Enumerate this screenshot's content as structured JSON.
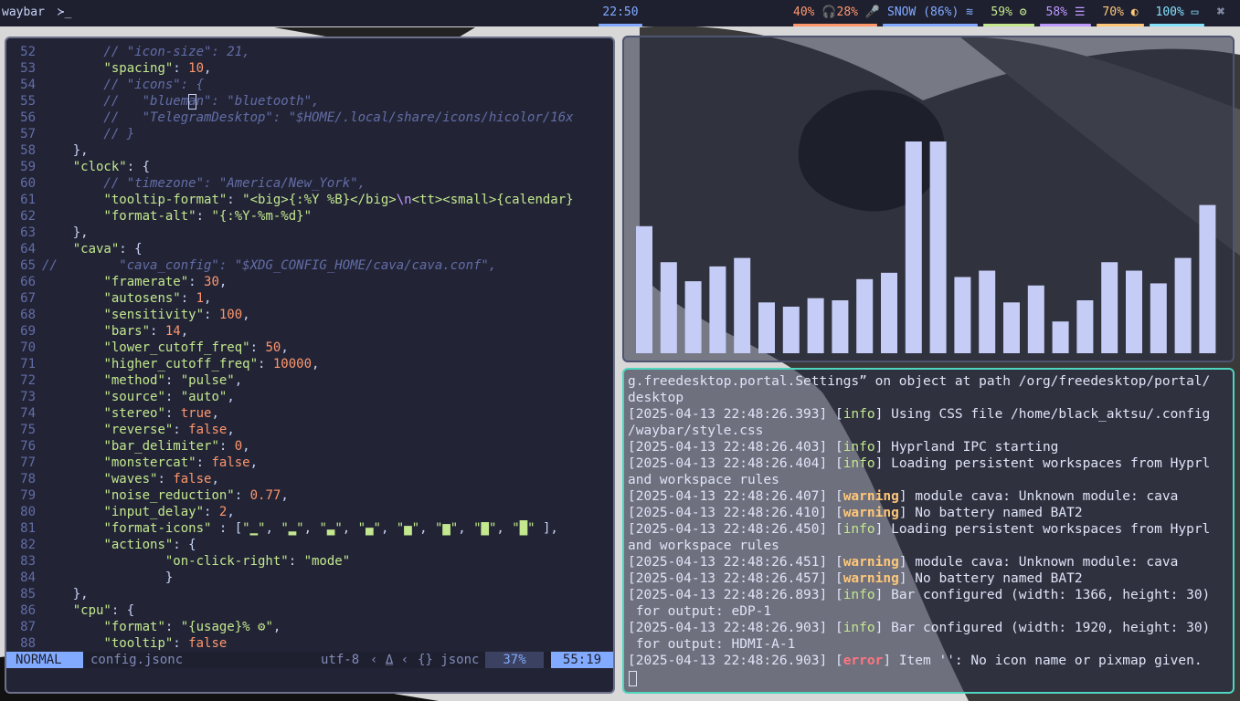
{
  "topbar": {
    "app_name": "waybar",
    "clock": "22:50",
    "volume": "40%",
    "headset": "28%",
    "network": "SNOW (86%)",
    "cpu": "59%",
    "memory": "58%",
    "backlight": "70%",
    "battery": "100%",
    "colors": {
      "bg": "#1e2030",
      "clock": "#82aaff",
      "volume": "#ff966c",
      "network": "#82aaff",
      "cpu": "#c3e88d",
      "memory": "#c099ff",
      "backlight": "#ffc777",
      "battery": "#86e1fc"
    }
  },
  "editor": {
    "lines": [
      {
        "n": "52",
        "t": [
          [
            "c",
            "        // \"icon-size\": 21,"
          ]
        ]
      },
      {
        "n": "53",
        "t": [
          [
            "p",
            "        "
          ],
          [
            "k",
            "\"spacing\""
          ],
          [
            "p",
            ": "
          ],
          [
            "n",
            "10"
          ],
          [
            "p",
            ","
          ]
        ]
      },
      {
        "n": "54",
        "t": [
          [
            "c",
            "        // \"icons\": {"
          ]
        ]
      },
      {
        "n": "55",
        "t": [
          [
            "c",
            "        //   \"blueman\": \"bluetooth\","
          ]
        ]
      },
      {
        "n": "56",
        "t": [
          [
            "c",
            "        //   \"TelegramDesktop\": \"$HOME/.local/share/icons/hicolor/16x"
          ]
        ]
      },
      {
        "n": "57",
        "t": [
          [
            "c",
            "        // }"
          ]
        ]
      },
      {
        "n": "58",
        "t": [
          [
            "p",
            "    },"
          ]
        ]
      },
      {
        "n": "59",
        "t": [
          [
            "p",
            "    "
          ],
          [
            "k",
            "\"clock\""
          ],
          [
            "p",
            ": {"
          ]
        ]
      },
      {
        "n": "60",
        "t": [
          [
            "c",
            "        // \"timezone\": \"America/New_York\","
          ]
        ]
      },
      {
        "n": "61",
        "t": [
          [
            "p",
            "        "
          ],
          [
            "k",
            "\"tooltip-format\""
          ],
          [
            "p",
            ": "
          ],
          [
            "s",
            "\"<big>{:%Y %B}</big>"
          ],
          [
            "e",
            "\\n"
          ],
          [
            "s",
            "<tt><small>{calendar}"
          ]
        ]
      },
      {
        "n": "62",
        "t": [
          [
            "p",
            "        "
          ],
          [
            "k",
            "\"format-alt\""
          ],
          [
            "p",
            ": "
          ],
          [
            "s",
            "\"{:%Y-%m-%d}\""
          ]
        ]
      },
      {
        "n": "63",
        "t": [
          [
            "p",
            "    },"
          ]
        ]
      },
      {
        "n": "64",
        "t": [
          [
            "p",
            "    "
          ],
          [
            "k",
            "\"cava\""
          ],
          [
            "p",
            ": {"
          ]
        ]
      },
      {
        "n": "65",
        "t": [
          [
            "c",
            "//        \"cava_config\": \"$XDG_CONFIG_HOME/cava/cava.conf\","
          ]
        ]
      },
      {
        "n": "66",
        "t": [
          [
            "p",
            "        "
          ],
          [
            "k",
            "\"framerate\""
          ],
          [
            "p",
            ": "
          ],
          [
            "n",
            "30"
          ],
          [
            "p",
            ","
          ]
        ]
      },
      {
        "n": "67",
        "t": [
          [
            "p",
            "        "
          ],
          [
            "k",
            "\"autosens\""
          ],
          [
            "p",
            ": "
          ],
          [
            "n",
            "1"
          ],
          [
            "p",
            ","
          ]
        ]
      },
      {
        "n": "68",
        "t": [
          [
            "p",
            "        "
          ],
          [
            "k",
            "\"sensitivity\""
          ],
          [
            "p",
            ": "
          ],
          [
            "n",
            "100"
          ],
          [
            "p",
            ","
          ]
        ]
      },
      {
        "n": "69",
        "t": [
          [
            "p",
            "        "
          ],
          [
            "k",
            "\"bars\""
          ],
          [
            "p",
            ": "
          ],
          [
            "n",
            "14"
          ],
          [
            "p",
            ","
          ]
        ]
      },
      {
        "n": "70",
        "t": [
          [
            "p",
            "        "
          ],
          [
            "k",
            "\"lower_cutoff_freq\""
          ],
          [
            "p",
            ": "
          ],
          [
            "n",
            "50"
          ],
          [
            "p",
            ","
          ]
        ]
      },
      {
        "n": "71",
        "t": [
          [
            "p",
            "        "
          ],
          [
            "k",
            "\"higher_cutoff_freq\""
          ],
          [
            "p",
            ": "
          ],
          [
            "n",
            "10000"
          ],
          [
            "p",
            ","
          ]
        ]
      },
      {
        "n": "72",
        "t": [
          [
            "p",
            "        "
          ],
          [
            "k",
            "\"method\""
          ],
          [
            "p",
            ": "
          ],
          [
            "s",
            "\"pulse\""
          ],
          [
            "p",
            ","
          ]
        ]
      },
      {
        "n": "73",
        "t": [
          [
            "p",
            "        "
          ],
          [
            "k",
            "\"source\""
          ],
          [
            "p",
            ": "
          ],
          [
            "s",
            "\"auto\""
          ],
          [
            "p",
            ","
          ]
        ]
      },
      {
        "n": "74",
        "t": [
          [
            "p",
            "        "
          ],
          [
            "k",
            "\"stereo\""
          ],
          [
            "p",
            ": "
          ],
          [
            "n",
            "true"
          ],
          [
            "p",
            ","
          ]
        ]
      },
      {
        "n": "75",
        "t": [
          [
            "p",
            "        "
          ],
          [
            "k",
            "\"reverse\""
          ],
          [
            "p",
            ": "
          ],
          [
            "n",
            "false"
          ],
          [
            "p",
            ","
          ]
        ]
      },
      {
        "n": "76",
        "t": [
          [
            "p",
            "        "
          ],
          [
            "k",
            "\"bar_delimiter\""
          ],
          [
            "p",
            ": "
          ],
          [
            "n",
            "0"
          ],
          [
            "p",
            ","
          ]
        ]
      },
      {
        "n": "77",
        "t": [
          [
            "p",
            "        "
          ],
          [
            "k",
            "\"monstercat\""
          ],
          [
            "p",
            ": "
          ],
          [
            "n",
            "false"
          ],
          [
            "p",
            ","
          ]
        ]
      },
      {
        "n": "78",
        "t": [
          [
            "p",
            "        "
          ],
          [
            "k",
            "\"waves\""
          ],
          [
            "p",
            ": "
          ],
          [
            "n",
            "false"
          ],
          [
            "p",
            ","
          ]
        ]
      },
      {
        "n": "79",
        "t": [
          [
            "p",
            "        "
          ],
          [
            "k",
            "\"noise_reduction\""
          ],
          [
            "p",
            ": "
          ],
          [
            "n",
            "0.77"
          ],
          [
            "p",
            ","
          ]
        ]
      },
      {
        "n": "80",
        "t": [
          [
            "p",
            "        "
          ],
          [
            "k",
            "\"input_delay\""
          ],
          [
            "p",
            ": "
          ],
          [
            "n",
            "2"
          ],
          [
            "p",
            ","
          ]
        ]
      },
      {
        "n": "81",
        "t": [
          [
            "p",
            "        "
          ],
          [
            "k",
            "\"format-icons\""
          ],
          [
            "p",
            " : ["
          ],
          [
            "s",
            "\"▁\""
          ],
          [
            "p",
            ", "
          ],
          [
            "s",
            "\"▂\""
          ],
          [
            "p",
            ", "
          ],
          [
            "s",
            "\"▃\""
          ],
          [
            "p",
            ", "
          ],
          [
            "s",
            "\"▄\""
          ],
          [
            "p",
            ", "
          ],
          [
            "s",
            "\"▅\""
          ],
          [
            "p",
            ", "
          ],
          [
            "s",
            "\"▆\""
          ],
          [
            "p",
            ", "
          ],
          [
            "s",
            "\"▇\""
          ],
          [
            "p",
            ", "
          ],
          [
            "s",
            "\"█\""
          ],
          [
            "p",
            " ],"
          ]
        ]
      },
      {
        "n": "82",
        "t": [
          [
            "p",
            "        "
          ],
          [
            "k",
            "\"actions\""
          ],
          [
            "p",
            ": {"
          ]
        ]
      },
      {
        "n": "83",
        "t": [
          [
            "p",
            "                "
          ],
          [
            "k",
            "\"on-click-right\""
          ],
          [
            "p",
            ": "
          ],
          [
            "s",
            "\"mode\""
          ]
        ]
      },
      {
        "n": "84",
        "t": [
          [
            "p",
            "                }"
          ]
        ]
      },
      {
        "n": "85",
        "t": [
          [
            "p",
            "    },"
          ]
        ]
      },
      {
        "n": "86",
        "t": [
          [
            "p",
            "    "
          ],
          [
            "k",
            "\"cpu\""
          ],
          [
            "p",
            ": {"
          ]
        ]
      },
      {
        "n": "87",
        "t": [
          [
            "p",
            "        "
          ],
          [
            "k",
            "\"format\""
          ],
          [
            "p",
            ": "
          ],
          [
            "s",
            "\"{usage}% ⚙\""
          ],
          [
            "p",
            ","
          ]
        ]
      },
      {
        "n": "88",
        "t": [
          [
            "p",
            "        "
          ],
          [
            "k",
            "\"tooltip\""
          ],
          [
            "p",
            ": "
          ],
          [
            "n",
            "false"
          ]
        ]
      }
    ],
    "status": {
      "mode": "NORMAL",
      "file": "config.jsonc",
      "encoding": "utf-8",
      "filetype": "{} jsonc",
      "percent": "37%",
      "position": "55:19"
    }
  },
  "cava": {
    "levels": [
      0.6,
      0.43,
      0.34,
      0.41,
      0.45,
      0.24,
      0.22,
      0.26,
      0.25,
      0.35,
      0.38,
      1.0,
      1.0,
      0.36,
      0.39,
      0.24,
      0.32,
      0.15,
      0.25,
      0.43,
      0.39,
      0.33,
      0.45,
      0.7
    ],
    "bar_color": "#c5cdf6"
  },
  "terminal": {
    "lines": [
      [
        [
          "t",
          "g.freedesktop.portal.Settings” on object at path /org/freedesktop/portal/"
        ]
      ],
      [
        [
          "t",
          "desktop"
        ]
      ],
      [
        [
          "t",
          "[2025-04-13 22:48:26.393] ["
        ],
        [
          "i",
          "info"
        ],
        [
          "t",
          "] Using CSS file /home/black_aktsu/.config"
        ]
      ],
      [
        [
          "t",
          "/waybar/style.css"
        ]
      ],
      [
        [
          "t",
          "[2025-04-13 22:48:26.403] ["
        ],
        [
          "i",
          "info"
        ],
        [
          "t",
          "] Hyprland IPC starting"
        ]
      ],
      [
        [
          "t",
          "[2025-04-13 22:48:26.404] ["
        ],
        [
          "i",
          "info"
        ],
        [
          "t",
          "] Loading persistent workspaces from Hyprl"
        ]
      ],
      [
        [
          "t",
          "and workspace rules"
        ]
      ],
      [
        [
          "t",
          "[2025-04-13 22:48:26.407] ["
        ],
        [
          "w",
          "warning"
        ],
        [
          "t",
          "] module cava: Unknown module: cava"
        ]
      ],
      [
        [
          "t",
          "[2025-04-13 22:48:26.410] ["
        ],
        [
          "w",
          "warning"
        ],
        [
          "t",
          "] No battery named BAT2"
        ]
      ],
      [
        [
          "t",
          "[2025-04-13 22:48:26.450] ["
        ],
        [
          "i",
          "info"
        ],
        [
          "t",
          "] Loading persistent workspaces from Hyprl"
        ]
      ],
      [
        [
          "t",
          "and workspace rules"
        ]
      ],
      [
        [
          "t",
          "[2025-04-13 22:48:26.451] ["
        ],
        [
          "w",
          "warning"
        ],
        [
          "t",
          "] module cava: Unknown module: cava"
        ]
      ],
      [
        [
          "t",
          "[2025-04-13 22:48:26.457] ["
        ],
        [
          "w",
          "warning"
        ],
        [
          "t",
          "] No battery named BAT2"
        ]
      ],
      [
        [
          "t",
          "[2025-04-13 22:48:26.893] ["
        ],
        [
          "i",
          "info"
        ],
        [
          "t",
          "] Bar configured (width: 1366, height: 30)"
        ]
      ],
      [
        [
          "t",
          " for output: eDP-1"
        ]
      ],
      [
        [
          "t",
          "[2025-04-13 22:48:26.903] ["
        ],
        [
          "i",
          "info"
        ],
        [
          "t",
          "] Bar configured (width: 1920, height: 30)"
        ]
      ],
      [
        [
          "t",
          " for output: HDMI-A-1"
        ]
      ],
      [
        [
          "t",
          "[2025-04-13 22:48:26.903] ["
        ],
        [
          "e",
          "error"
        ],
        [
          "t",
          "] Item '': No icon name or pixmap given."
        ]
      ]
    ]
  }
}
